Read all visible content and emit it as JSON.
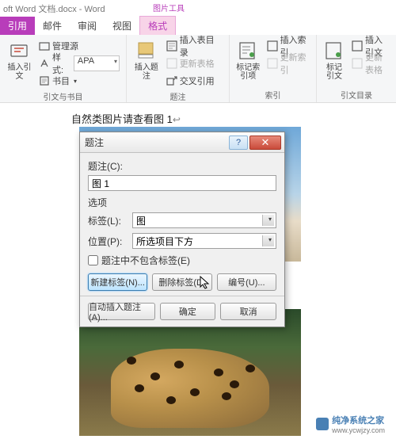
{
  "titlebar": {
    "doc_title": "oft Word 文档.docx - Word"
  },
  "contextual_label": "图片工具",
  "tabs": {
    "citation": "引用",
    "mail": "邮件",
    "review": "审阅",
    "view": "视图",
    "format": "格式"
  },
  "ribbon": {
    "insert_citation": "插入引文",
    "manage_sources": "管理源",
    "style_label": "样式:",
    "style_value": "APA",
    "bibliography": "书目",
    "group1_label": "引文与书目",
    "insert_caption": "插入题注",
    "insert_tof": "插入表目录",
    "update_table": "更新表格",
    "cross_ref": "交叉引用",
    "group2_label": "题注",
    "mark_entry": "标记索引项",
    "insert_index": "插入索引",
    "update_index": "更新索引",
    "group3_label": "索引",
    "mark_citation": "标记引文",
    "insert_toa": "插入引文",
    "update_toa": "更新表格",
    "group4_label": "引文目录"
  },
  "document": {
    "caption_ref_text": "自然类图片请查看图 1"
  },
  "dialog": {
    "title": "题注",
    "help": "?",
    "close": "✕",
    "caption_label": "题注(C):",
    "caption_value": "图 1",
    "options_label": "选项",
    "label_label": "标签(L):",
    "label_value": "图",
    "position_label": "位置(P):",
    "position_value": "所选项目下方",
    "exclude_label_check": "题注中不包含标签(E)",
    "new_label_btn": "新建标签(N)...",
    "delete_label_btn": "删除标签(D)",
    "numbering_btn": "编号(U)...",
    "auto_btn": "自动插入题注(A)...",
    "ok_btn": "确定",
    "cancel_btn": "取消"
  },
  "watermark": {
    "text": "纯净系统之家",
    "url": "www.ycwjzy.com"
  }
}
